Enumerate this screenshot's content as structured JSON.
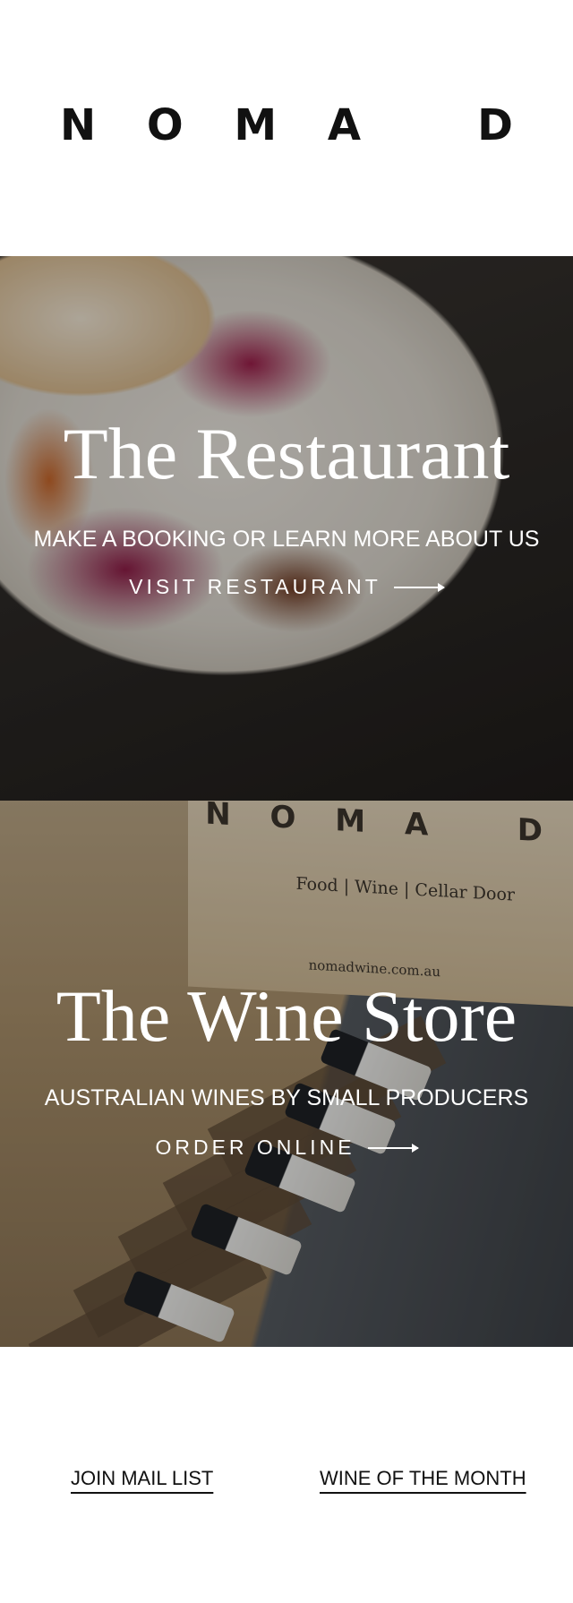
{
  "header": {
    "logo_text": "N O M A   D"
  },
  "restaurant": {
    "title": "The Restaurant",
    "subtitle": "MAKE A BOOKING OR LEARN MORE ABOUT US",
    "link_label": "VISIT RESTAURANT"
  },
  "wine": {
    "box_logo": "N O M A   D",
    "box_subtitle": "Food | Wine | Cellar Door",
    "box_url": "nomadwine.com.au",
    "title": "The Wine Store",
    "subtitle": "AUSTRALIAN WINES BY SMALL PRODUCERS",
    "link_label": "ORDER ONLINE"
  },
  "footer": {
    "join_label": "JOIN MAIL LIST",
    "wine_month_label": "WINE OF THE MONTH"
  }
}
